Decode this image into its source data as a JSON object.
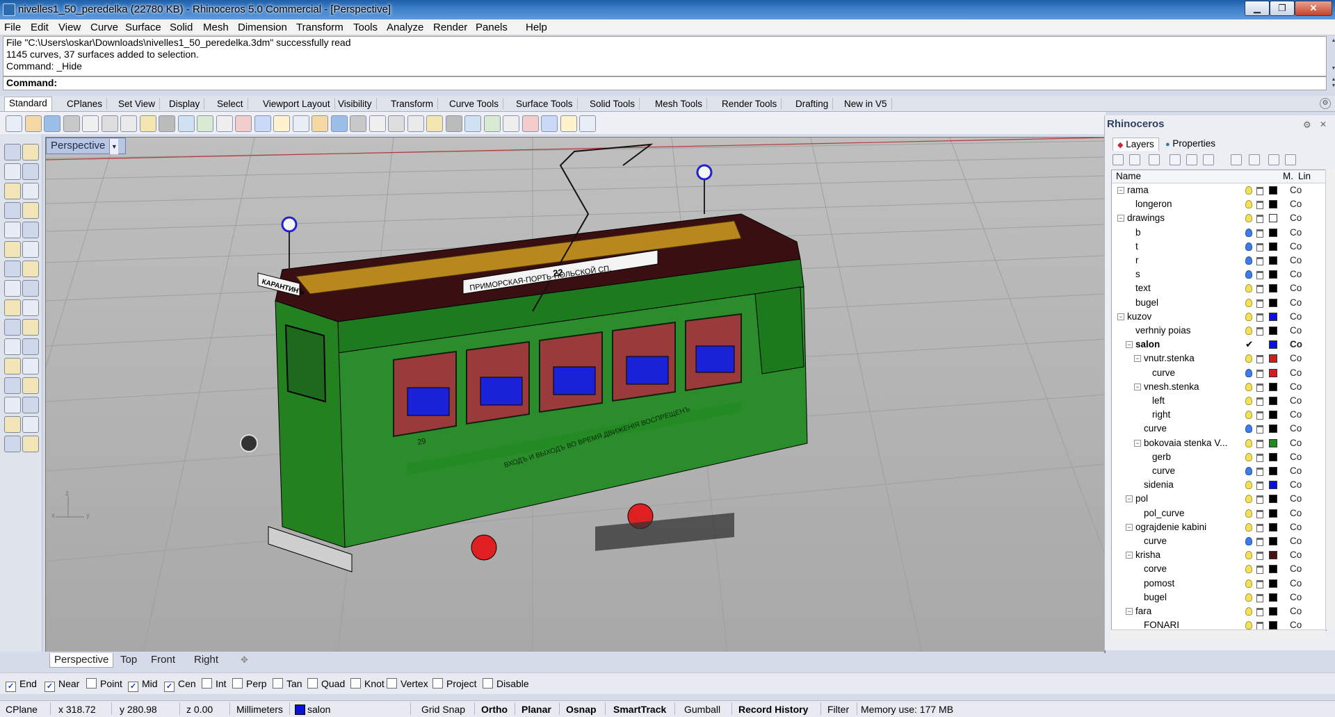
{
  "window": {
    "title": "nivelles1_50_peredelka (22780 KB) - Rhinoceros 5.0 Commercial - [Perspective]",
    "minimize": "▁",
    "maximize": "❐",
    "close": "✕"
  },
  "menu": [
    "File",
    "Edit",
    "View",
    "Curve",
    "Surface",
    "Solid",
    "Mesh",
    "Dimension",
    "Transform",
    "Tools",
    "Analyze",
    "Render",
    "Panels",
    "Help"
  ],
  "command_history": [
    "File \"C:\\Users\\oskar\\Downloads\\nivelles1_50_peredelka.3dm\" successfully read",
    "1145 curves, 37 surfaces added to selection.",
    "Command: _Hide"
  ],
  "command_prompt": "Command:",
  "toolbar_tabs": [
    "Standard",
    "CPlanes",
    "Set View",
    "Display",
    "Select",
    "Viewport Layout",
    "Visibility",
    "Transform",
    "Curve Tools",
    "Surface Tools",
    "Solid Tools",
    "Mesh Tools",
    "Render Tools",
    "Drafting",
    "New in V5"
  ],
  "toolbar_icons": [
    "new-icon",
    "open-icon",
    "save-icon",
    "print-icon",
    "import-icon",
    "cut-icon",
    "copy-icon",
    "paste-icon",
    "undo-icon",
    "pan-icon",
    "rotate-view-icon",
    "zoom-icon",
    "zoom-window-icon",
    "zoom-extents-icon",
    "zoom-selected-icon",
    "four-views-icon",
    "car-icon",
    "options-icon",
    "select-icon",
    "layer-icon",
    "lightbulb-icon",
    "lock-icon",
    "material-icon",
    "color-wheel-icon",
    "sphere-icon",
    "render-sphere-icon",
    "globe-icon",
    "pointer-icon",
    "properties-icon",
    "dimension-icon",
    "help-icon"
  ],
  "viewport": {
    "name": "Perspective",
    "tram_side_text": "ВХОДЪ И ВЫХОДЪ ВО ВРЕМЯ ДВИЖЕНIЯ ВОСПРЕЩЕНЪ",
    "tram_route_sign": "ПРИМОРСКАЯ-ПОРТЬ-ПОЛЬСКОЙ СП.",
    "tram_route_number": "22",
    "tram_front_sign": "КАРАНТИНЪ",
    "tram_fleet_number": "29",
    "axis_x": "x",
    "axis_y": "y",
    "axis_z": "z"
  },
  "view_tabs": [
    "Perspective",
    "Top",
    "Front",
    "Right"
  ],
  "view_tab_add": "✥",
  "osnaps": [
    {
      "label": "End",
      "checked": true
    },
    {
      "label": "Near",
      "checked": true
    },
    {
      "label": "Point",
      "checked": false
    },
    {
      "label": "Mid",
      "checked": true
    },
    {
      "label": "Cen",
      "checked": true
    },
    {
      "label": "Int",
      "checked": false
    },
    {
      "label": "Perp",
      "checked": false
    },
    {
      "label": "Tan",
      "checked": false
    },
    {
      "label": "Quad",
      "checked": false
    },
    {
      "label": "Knot",
      "checked": false
    },
    {
      "label": "Vertex",
      "checked": false
    },
    {
      "label": "Project",
      "checked": false
    },
    {
      "label": "Disable",
      "checked": false
    }
  ],
  "status": {
    "cplane": "CPlane",
    "x": "x 318.72",
    "y": "y 280.98",
    "z": "z 0.00",
    "units": "Millimeters",
    "layer": "salon",
    "layer_color": "#0a10e0",
    "grid_snap": "Grid Snap",
    "ortho": "Ortho",
    "planar": "Planar",
    "osnap": "Osnap",
    "smarttrack": "SmartTrack",
    "gumball": "Gumball",
    "record_history": "Record History",
    "filter": "Filter",
    "memory": "Memory use: 177 MB"
  },
  "panel": {
    "title": "Rhinoceros",
    "tabs": [
      "Layers",
      "Properties"
    ],
    "col_name": "Name",
    "col_m": "M.",
    "col_lin": "Lin",
    "current_check": "✔",
    "layers": [
      {
        "name": "rama",
        "indent": 0,
        "toggle": "−",
        "bulb": "yellow",
        "color": "#000000",
        "co": "Co"
      },
      {
        "name": "longeron",
        "indent": 1,
        "toggle": "",
        "bulb": "yellow",
        "color": "#000000",
        "co": "Co"
      },
      {
        "name": "drawings",
        "indent": 0,
        "toggle": "−",
        "bulb": "yellow",
        "color": "#ffffff",
        "co": "Co"
      },
      {
        "name": "b",
        "indent": 1,
        "toggle": "",
        "bulb": "blue",
        "color": "#000000",
        "co": "Co"
      },
      {
        "name": "t",
        "indent": 1,
        "toggle": "",
        "bulb": "blue",
        "color": "#000000",
        "co": "Co"
      },
      {
        "name": "r",
        "indent": 1,
        "toggle": "",
        "bulb": "blue",
        "color": "#000000",
        "co": "Co"
      },
      {
        "name": "s",
        "indent": 1,
        "toggle": "",
        "bulb": "blue",
        "color": "#000000",
        "co": "Co"
      },
      {
        "name": "text",
        "indent": 1,
        "toggle": "",
        "bulb": "yellow",
        "color": "#000000",
        "co": "Co"
      },
      {
        "name": "bugel",
        "indent": 1,
        "toggle": "",
        "bulb": "yellow",
        "color": "#000000",
        "co": "Co"
      },
      {
        "name": "kuzov",
        "indent": 0,
        "toggle": "−",
        "bulb": "yellow",
        "color": "#0a10e0",
        "co": "Co"
      },
      {
        "name": "verhniy poias",
        "indent": 1,
        "toggle": "",
        "bulb": "yellow",
        "color": "#000000",
        "co": "Co"
      },
      {
        "name": "salon",
        "indent": 1,
        "toggle": "−",
        "bulb": "",
        "color": "#0a10e0",
        "co": "Co",
        "current": true
      },
      {
        "name": "vnutr.stenka",
        "indent": 2,
        "toggle": "−",
        "bulb": "yellow",
        "color": "#cc2020",
        "co": "Co"
      },
      {
        "name": "curve",
        "indent": 3,
        "toggle": "",
        "bulb": "blue",
        "color": "#cc2020",
        "co": "Co"
      },
      {
        "name": "vnesh.stenka",
        "indent": 2,
        "toggle": "−",
        "bulb": "yellow",
        "color": "#000000",
        "co": "Co"
      },
      {
        "name": "left",
        "indent": 3,
        "toggle": "",
        "bulb": "yellow",
        "color": "#000000",
        "co": "Co"
      },
      {
        "name": "right",
        "indent": 3,
        "toggle": "",
        "bulb": "yellow",
        "color": "#000000",
        "co": "Co"
      },
      {
        "name": "curve",
        "indent": 2,
        "toggle": "",
        "bulb": "blue",
        "color": "#000000",
        "co": "Co"
      },
      {
        "name": "bokovaia stenka V...",
        "indent": 2,
        "toggle": "−",
        "bulb": "yellow",
        "color": "#1c8c1c",
        "co": "Co"
      },
      {
        "name": "gerb",
        "indent": 3,
        "toggle": "",
        "bulb": "yellow",
        "color": "#000000",
        "co": "Co"
      },
      {
        "name": "curve",
        "indent": 3,
        "toggle": "",
        "bulb": "blue",
        "color": "#000000",
        "co": "Co"
      },
      {
        "name": "sidenia",
        "indent": 2,
        "toggle": "",
        "bulb": "yellow",
        "color": "#0a10e0",
        "co": "Co"
      },
      {
        "name": "pol",
        "indent": 1,
        "toggle": "−",
        "bulb": "yellow",
        "color": "#000000",
        "co": "Co"
      },
      {
        "name": "pol_curve",
        "indent": 2,
        "toggle": "",
        "bulb": "yellow",
        "color": "#000000",
        "co": "Co"
      },
      {
        "name": "ograjdenie kabini",
        "indent": 1,
        "toggle": "−",
        "bulb": "yellow",
        "color": "#000000",
        "co": "Co"
      },
      {
        "name": "curve",
        "indent": 2,
        "toggle": "",
        "bulb": "blue",
        "color": "#000000",
        "co": "Co"
      },
      {
        "name": "krisha",
        "indent": 1,
        "toggle": "−",
        "bulb": "yellow",
        "color": "#4a1010",
        "co": "Co"
      },
      {
        "name": "corve",
        "indent": 2,
        "toggle": "",
        "bulb": "yellow",
        "color": "#000000",
        "co": "Co"
      },
      {
        "name": "pomost",
        "indent": 2,
        "toggle": "",
        "bulb": "yellow",
        "color": "#000000",
        "co": "Co"
      },
      {
        "name": "bugel",
        "indent": 2,
        "toggle": "",
        "bulb": "yellow",
        "color": "#000000",
        "co": "Co"
      },
      {
        "name": "fara",
        "indent": 1,
        "toggle": "−",
        "bulb": "yellow",
        "color": "#000000",
        "co": "Co"
      },
      {
        "name": "FONARI",
        "indent": 2,
        "toggle": "",
        "bulb": "yellow",
        "color": "#000000",
        "co": "Co"
      }
    ]
  }
}
